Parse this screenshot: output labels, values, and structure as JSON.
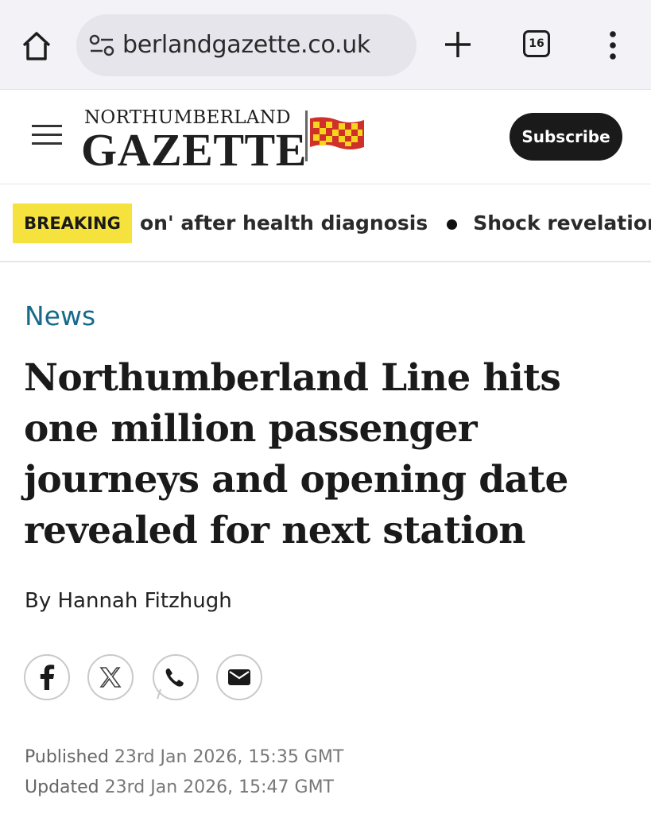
{
  "browser": {
    "url": "berlandgazette.co.uk",
    "tab_count": "16",
    "icons": [
      "home-icon",
      "site-info-icon",
      "plus-icon",
      "tab-switcher-icon",
      "more-vert-icon"
    ]
  },
  "header": {
    "logo_top": "NORTHUMBERLAND",
    "logo_bottom": "GAZETTE",
    "subscribe_label": "Subscribe",
    "icons": [
      "hamburger-menu-icon",
      "northumberland-flag-icon"
    ]
  },
  "breaking": {
    "badge": "BREAKING",
    "item1": "on' after health diagnosis",
    "item2": "Shock revelations"
  },
  "article": {
    "section": "News",
    "headline": "Northumberland Line hits one million passenger journeys and opening date revealed for next station",
    "byline": "By Hannah Fitzhugh",
    "published_label": "Published",
    "published_value": "23rd Jan 2026, 15:35 GMT",
    "updated_label": "Updated",
    "updated_value": "23rd Jan 2026, 15:47 GMT"
  },
  "share": {
    "icons": [
      "facebook-icon",
      "x-icon",
      "whatsapp-icon",
      "email-icon"
    ]
  },
  "colors": {
    "section_accent": "#166a8a",
    "breaking_badge": "#f5e23c",
    "subscribe_bg": "#1a1a1a",
    "flag_red": "#d0302a",
    "flag_yellow": "#f6d61c"
  }
}
